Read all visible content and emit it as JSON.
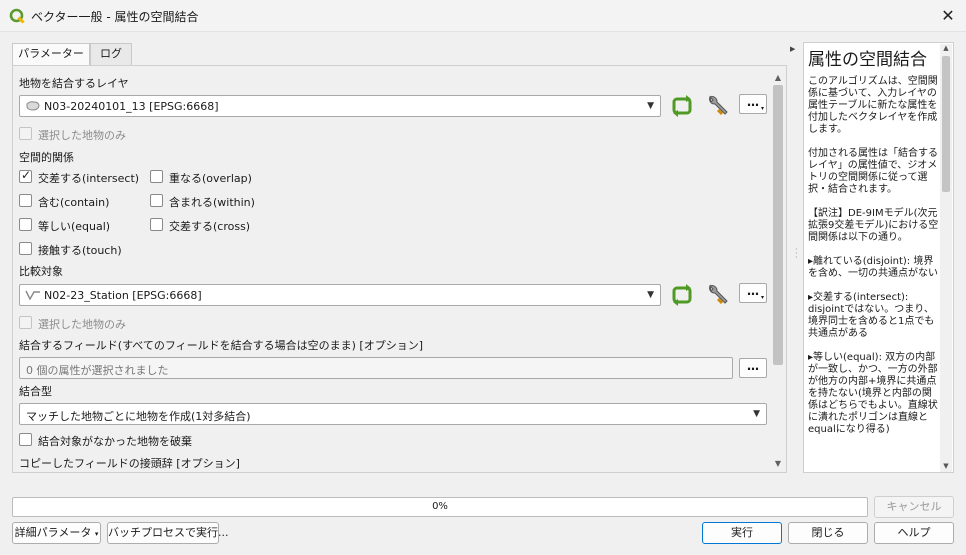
{
  "window": {
    "title": "ベクター一般 - 属性の空間結合",
    "close_label": "✕"
  },
  "tabs": [
    {
      "label": "パラメーター",
      "active": true
    },
    {
      "label": "ログ",
      "active": false
    }
  ],
  "params": {
    "input_layer_label": "地物を結合するレイヤ",
    "input_layer_value": "N03-20240101_13 [EPSG:6668]",
    "input_selected_only": "選択した地物のみ",
    "spatial_relation_label": "空間的関係",
    "predicates": [
      {
        "label": "交差する(intersect)",
        "checked": true
      },
      {
        "label": "重なる(overlap)",
        "checked": false
      },
      {
        "label": "含む(contain)",
        "checked": false
      },
      {
        "label": "含まれる(within)",
        "checked": false
      },
      {
        "label": "等しい(equal)",
        "checked": false
      },
      {
        "label": "交差する(cross)",
        "checked": false
      },
      {
        "label": "接触する(touch)",
        "checked": false
      }
    ],
    "join_layer_label": "比較対象",
    "join_layer_value": "N02-23_Station [EPSG:6668]",
    "join_selected_only": "選択した地物のみ",
    "fields_label": "結合するフィールド(すべてのフィールドを結合する場合は空のまま) [オプション]",
    "fields_value": "0 個の属性が選択されました",
    "join_type_label": "結合型",
    "join_type_value": "マッチした地物ごとに地物を作成(1対多結合)",
    "discard_label": "結合対象がなかった地物を破棄",
    "prefix_label": "コピーしたフィールドの接頭辞 [オプション]",
    "dots_label": "…"
  },
  "help": {
    "title": "属性の空間結合",
    "paragraphs": [
      "このアルゴリズムは、空間関係に基づいて、入力レイヤの属性テーブルに新たな属性を付加したベクタレイヤを作成します。",
      "付加される属性は「結合するレイヤ」の属性値で、ジオメトリの空間関係に従って選択・結合されます。",
      "【訳注】DE-9IMモデル(次元拡張9交差モデル)における空間関係は以下の通り。",
      "▸離れている(disjoint): 境界を含め、一切の共通点がない",
      "▸交差する(intersect): disjointではない。つまり、境界同士を含めると1点でも共通点がある",
      "▸等しい(equal): 双方の内部が一致し、かつ、一方の外部が他方の内部+境界に共通点を持たない(境界と内部の関係はどちらでもよい。直線状に潰れたポリゴンは直線とequalになり得る)"
    ]
  },
  "progress": {
    "value": 0,
    "text": "0%"
  },
  "buttons": {
    "cancel": "キャンセル",
    "advanced": "詳細パラメータ",
    "batch": "バッチプロセスで実行...",
    "run": "実行",
    "close": "閉じる",
    "help": "ヘルプ"
  }
}
